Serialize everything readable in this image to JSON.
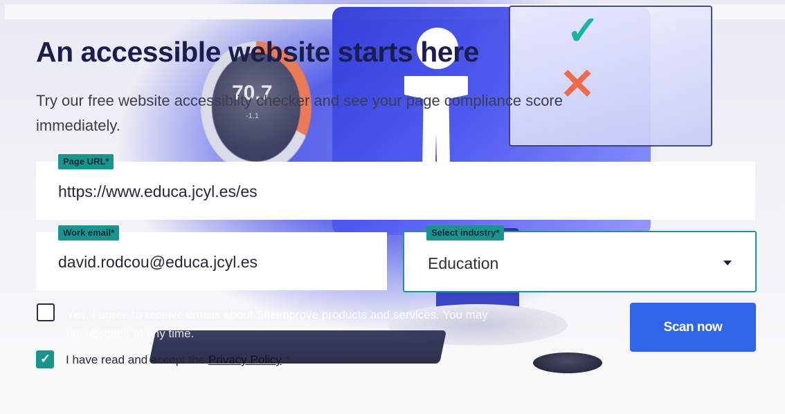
{
  "hero": {
    "title": "An accessible website starts here",
    "description": "Try our free website accessiblity checker and see your page compliance score immediately.",
    "graphic": {
      "score": "70.7",
      "delta": "-1.1"
    }
  },
  "form": {
    "page_url": {
      "label": "Page URL*",
      "value": "https://www.educa.jcyl.es/es"
    },
    "work_email": {
      "label": "Work email*",
      "value": "david.rodcou@educa.jcyl.es"
    },
    "industry": {
      "label": "Select industry*",
      "value": "Education"
    },
    "consent": {
      "checked": false,
      "text": "Yes, I agree to receive emails about Siteimprove products and services. You may unsubscribe at any time."
    },
    "privacy": {
      "checked": true,
      "prefix": "I have read and accept the ",
      "link": "Privacy Policy",
      "suffix": " *"
    },
    "submit_label": "Scan now"
  },
  "colors": {
    "accent_teal": "#19958e",
    "button_blue": "#2f66e8",
    "heading": "#1a1d4e"
  }
}
